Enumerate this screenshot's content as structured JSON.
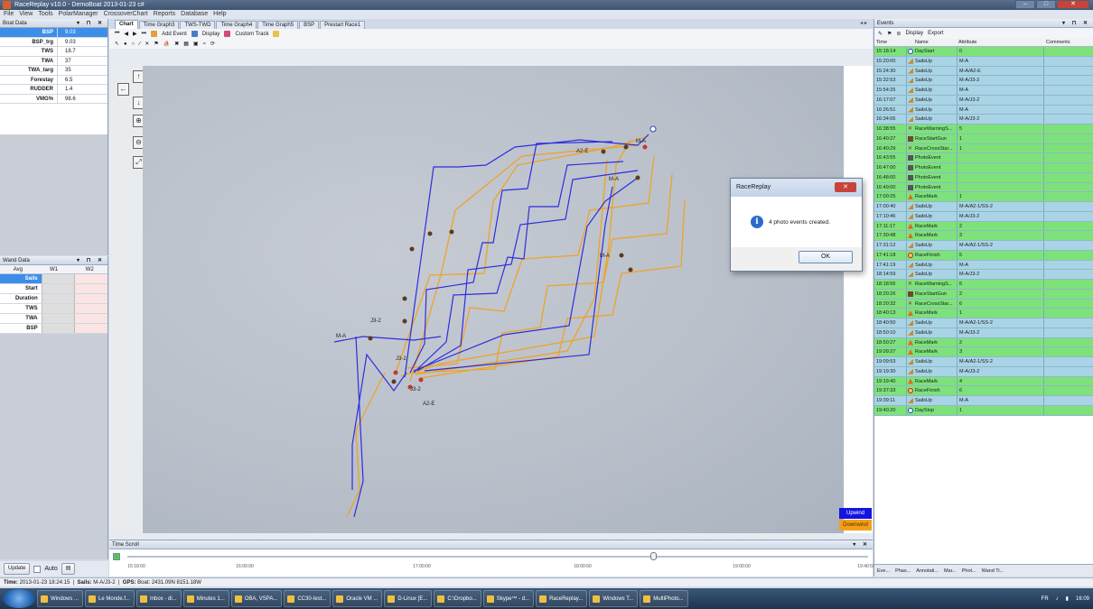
{
  "window": {
    "title": "RaceReplay v10.0 - DemoBoat 2013-01-23 c#"
  },
  "menu": [
    "File",
    "View",
    "Tools",
    "PolarManager",
    "CrossoverChart",
    "Reports",
    "Database",
    "Help"
  ],
  "boat_data": {
    "title": "Boat Data",
    "rows": [
      {
        "key": "BSP",
        "value": "9.03"
      },
      {
        "key": "BSP_trg",
        "value": "9.03"
      },
      {
        "key": "TWS",
        "value": "18.7"
      },
      {
        "key": "TWA",
        "value": "37"
      },
      {
        "key": "TWA_targ",
        "value": "35"
      },
      {
        "key": "Forestay",
        "value": "6.5"
      },
      {
        "key": "RUDDER",
        "value": "1.4"
      },
      {
        "key": "VMG%",
        "value": "98.6"
      }
    ]
  },
  "wand_data": {
    "title": "Wand Data",
    "cols": [
      "Avg",
      "W1",
      "W2"
    ],
    "rows": [
      "Sails",
      "Start",
      "Duration",
      "TWS",
      "TWA",
      "BSP"
    ]
  },
  "left_bottom": {
    "update": "Update",
    "auto": "Auto"
  },
  "tabs": [
    "Chart",
    "Time Graph3",
    "TWS-TWD",
    "Time Graph4",
    "Time Graph5",
    "BSP",
    "Prestart Race1"
  ],
  "toolbar": {
    "add_event": "Add Event",
    "display": "Display",
    "custom_track": "Custom Track"
  },
  "map": {
    "labels": [
      "M-A",
      "A2-E",
      "M-A",
      "M-A",
      "J3-2",
      "J3-2",
      "J3-2",
      "A2-E",
      "M-A"
    ],
    "legend": [
      {
        "label": "Upwind",
        "color": "#1414e0"
      },
      {
        "label": "Downwind",
        "color": "#f2a019"
      }
    ]
  },
  "time_scroll": {
    "title": "Time Scroll",
    "ticks": [
      "15:18:00",
      "16:00:00",
      "17:00:00",
      "18:00:00",
      "19:00:00",
      "19:40:50"
    ],
    "position": 0.71
  },
  "events": {
    "title": "Events",
    "toolbar": {
      "display": "Display",
      "export": "Export"
    },
    "columns": [
      "Time",
      "Name",
      "Attribute",
      "Comments"
    ],
    "rows": [
      {
        "time": "15:18:14",
        "icon": "circle",
        "name": "DayStart",
        "attr": "0",
        "color": "green"
      },
      {
        "time": "15:20:00",
        "icon": "sail",
        "name": "SailsUp",
        "attr": "M-A",
        "color": "blue"
      },
      {
        "time": "15:24:30",
        "icon": "sail",
        "name": "SailsUp",
        "attr": "M-A/A2-E",
        "color": "blue"
      },
      {
        "time": "15:32:53",
        "icon": "sail",
        "name": "SailsUp",
        "attr": "M-A/J3-2",
        "color": "blue"
      },
      {
        "time": "15:54:25",
        "icon": "sail",
        "name": "SailsUp",
        "attr": "M-A",
        "color": "blue"
      },
      {
        "time": "16:17:07",
        "icon": "sail",
        "name": "SailsUp",
        "attr": "M-A/J3-2",
        "color": "blue"
      },
      {
        "time": "16:26:51",
        "icon": "sail",
        "name": "SailsUp",
        "attr": "M-A",
        "color": "blue"
      },
      {
        "time": "16:34:06",
        "icon": "sail",
        "name": "SailsUp",
        "attr": "M-A/J3-2",
        "color": "blue"
      },
      {
        "time": "16:38:55",
        "icon": "cross",
        "name": "RaceWarningS...",
        "attr": "5",
        "color": "green"
      },
      {
        "time": "16:40:27",
        "icon": "flag",
        "name": "RaceStartGun",
        "attr": "1",
        "color": "green"
      },
      {
        "time": "16:40:29",
        "icon": "cross",
        "name": "RaceCrossStar...",
        "attr": "1",
        "color": "green"
      },
      {
        "time": "16:43:55",
        "icon": "photo",
        "name": "PhotoEvent",
        "attr": "",
        "color": "green"
      },
      {
        "time": "16:47:00",
        "icon": "photo",
        "name": "PhotoEvent",
        "attr": "",
        "color": "green"
      },
      {
        "time": "16:48:00",
        "icon": "photo",
        "name": "PhotoEvent",
        "attr": "",
        "color": "green"
      },
      {
        "time": "16:49:00",
        "icon": "photo",
        "name": "PhotoEvent",
        "attr": "",
        "color": "green"
      },
      {
        "time": "17:00:25",
        "icon": "mark",
        "name": "RaceMark",
        "attr": "1",
        "color": "green"
      },
      {
        "time": "17:00:40",
        "icon": "sail",
        "name": "SailsUp",
        "attr": "M-A/A2-1/SS-2",
        "color": "blue"
      },
      {
        "time": "17:10:46",
        "icon": "sail",
        "name": "SailsUp",
        "attr": "M-A/J3-2",
        "color": "blue"
      },
      {
        "time": "17:11:17",
        "icon": "mark",
        "name": "RaceMark",
        "attr": "2",
        "color": "green"
      },
      {
        "time": "17:30:48",
        "icon": "mark",
        "name": "RaceMark",
        "attr": "3",
        "color": "green"
      },
      {
        "time": "17:31:12",
        "icon": "sail",
        "name": "SailsUp",
        "attr": "M-A/A2-1/SS-2",
        "color": "blue"
      },
      {
        "time": "17:41:18",
        "icon": "finish",
        "name": "RaceFinish",
        "attr": "5",
        "color": "green"
      },
      {
        "time": "17:41:19",
        "icon": "sail",
        "name": "SailsUp",
        "attr": "M-A",
        "color": "blue"
      },
      {
        "time": "18:14:59",
        "icon": "sail",
        "name": "SailsUp",
        "attr": "M-A/J3-2",
        "color": "blue"
      },
      {
        "time": "18:18:56",
        "icon": "cross",
        "name": "RaceWarningS...",
        "attr": "6",
        "color": "green"
      },
      {
        "time": "18:20:26",
        "icon": "flag",
        "name": "RaceStartGun",
        "attr": "2",
        "color": "green"
      },
      {
        "time": "18:20:32",
        "icon": "cross",
        "name": "RaceCrossStar...",
        "attr": "6",
        "color": "green"
      },
      {
        "time": "18:40:13",
        "icon": "mark",
        "name": "RaceMark",
        "attr": "1",
        "color": "green"
      },
      {
        "time": "18:40:50",
        "icon": "sail",
        "name": "SailsUp",
        "attr": "M-A/A2-1/SS-2",
        "color": "blue"
      },
      {
        "time": "18:50:10",
        "icon": "sail",
        "name": "SailsUp",
        "attr": "M-A/J3-2",
        "color": "blue"
      },
      {
        "time": "18:50:27",
        "icon": "mark",
        "name": "RaceMark",
        "attr": "2",
        "color": "green"
      },
      {
        "time": "19:09:27",
        "icon": "mark",
        "name": "RaceMark",
        "attr": "3",
        "color": "green"
      },
      {
        "time": "19:09:53",
        "icon": "sail",
        "name": "SailsUp",
        "attr": "M-A/A2-1/SS-2",
        "color": "blue"
      },
      {
        "time": "19:19:30",
        "icon": "sail",
        "name": "SailsUp",
        "attr": "M-A/J3-2",
        "color": "blue"
      },
      {
        "time": "19:19:40",
        "icon": "mark",
        "name": "RaceMark",
        "attr": "4",
        "color": "green"
      },
      {
        "time": "19:37:33",
        "icon": "finish",
        "name": "RaceFinish",
        "attr": "6",
        "color": "green"
      },
      {
        "time": "19:39:11",
        "icon": "sail",
        "name": "SailsUp",
        "attr": "M-A",
        "color": "blue"
      },
      {
        "time": "19:40:20",
        "icon": "circle",
        "name": "DayStop",
        "attr": "1",
        "color": "green"
      }
    ],
    "bottom_tabs": [
      "Eve...",
      "Phas...",
      "Annotati...",
      "Mar...",
      "Phot...",
      "Wand Ti..."
    ]
  },
  "status": {
    "time_label": "Time:",
    "time": "2013-01-23 18:24:15",
    "sails_label": "Sails:",
    "sails": "M-A/J3-2",
    "gps_label": "GPS:",
    "gps": "Boat: 2431.09N 8151.18W"
  },
  "dialog": {
    "title": "RaceReplay",
    "message": "4 photo events created.",
    "ok": "OK"
  },
  "taskbar": {
    "items": [
      "Windows ...",
      "Le Monde.f...",
      "Inbox - di...",
      "Minutes 1...",
      "OBA, VSPA...",
      "CC30-test...",
      "Oracle VM ...",
      "D-Linux [E...",
      "C:\\Dropbo...",
      "Skype™ - d...",
      "RaceReplay...",
      "Windows T...",
      "MultiPhoto..."
    ],
    "lang": "FR",
    "clock": "16:09"
  },
  "colors": {
    "upwind": "#1414e0",
    "downwind": "#f2a019",
    "event_green": "#7de27a",
    "event_blue": "#a9d4e6"
  }
}
